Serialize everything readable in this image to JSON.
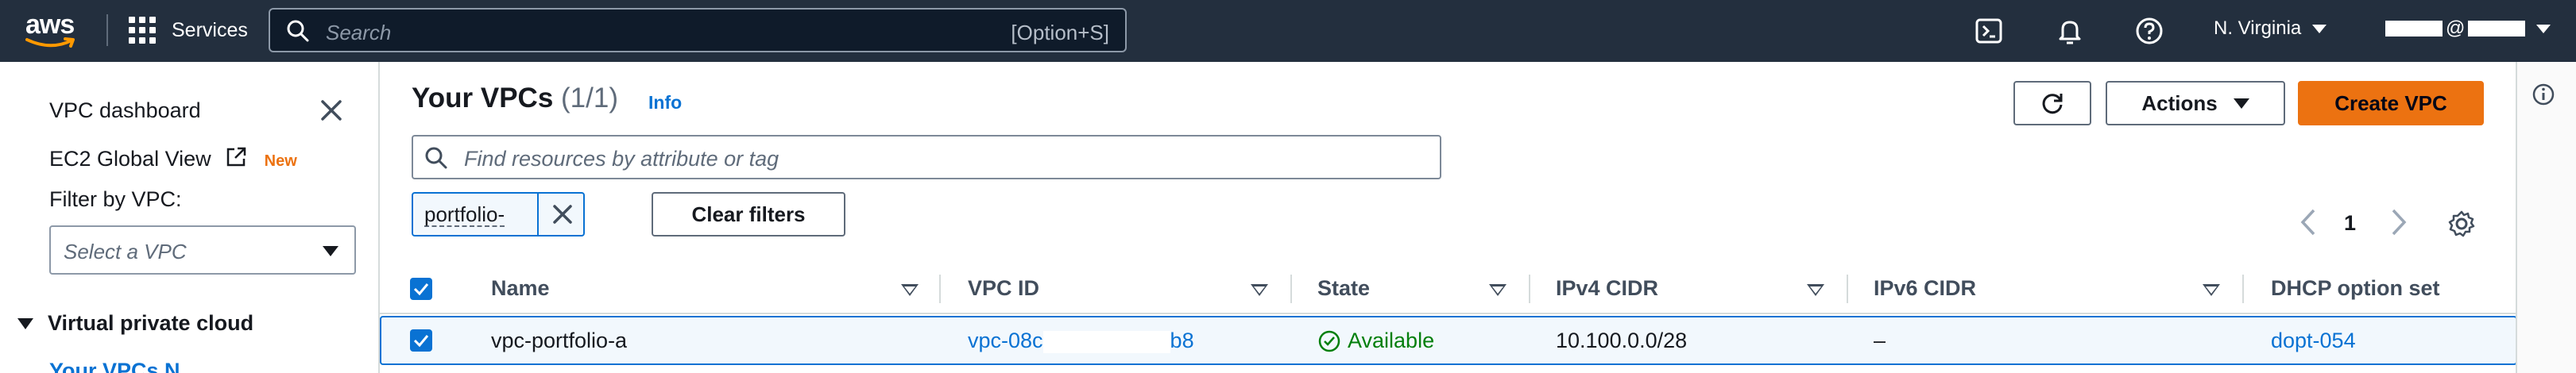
{
  "topnav": {
    "logo_text": "aws",
    "services_label": "Services",
    "search": {
      "placeholder": "Search",
      "shortcut": "[Option+S]"
    },
    "icons": [
      "cloudshell-icon",
      "notifications-icon",
      "help-icon"
    ],
    "region": "N. Virginia",
    "account_at": "@"
  },
  "sidepanel": {
    "dashboard_link": "VPC dashboard",
    "global_view_link": "EC2 Global View",
    "new_badge": "New",
    "filter_label": "Filter by VPC:",
    "filter_placeholder": "Select a VPC",
    "section_title": "Virtual private cloud",
    "partial_item": "Your VPCs  N"
  },
  "main": {
    "title": "Your VPCs",
    "count": "(1/1)",
    "info_link": "Info",
    "refresh_icon": "refresh-icon",
    "actions_label": "Actions",
    "create_label": "Create VPC",
    "search_placeholder": "Find resources by attribute or tag",
    "filter_token": "portfolio-",
    "clear_filters_label": "Clear filters",
    "page_number": "1"
  },
  "table": {
    "columns": [
      "Name",
      "VPC ID",
      "State",
      "IPv4 CIDR",
      "IPv6 CIDR",
      "DHCP option set"
    ],
    "rows": [
      {
        "name": "vpc-portfolio-a",
        "vpc_id_prefix": "vpc-08c",
        "vpc_id_suffix": "b8",
        "state": "Available",
        "ipv4": "10.100.0.0/28",
        "ipv6": "–",
        "dhcp": "dopt-054"
      }
    ]
  },
  "colors": {
    "nav_bg": "#232f3e",
    "primary": "#ec7211",
    "link": "#0972d3",
    "success": "#037f0c"
  }
}
